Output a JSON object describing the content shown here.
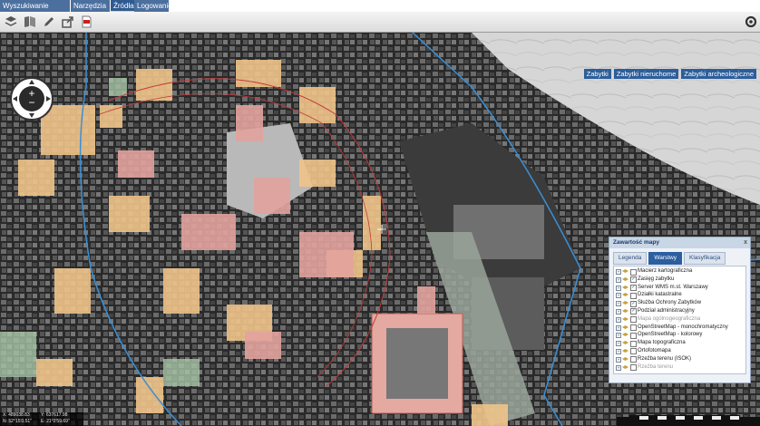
{
  "menu": {
    "tabs": [
      {
        "label": "Wyszukiwanie",
        "active": false
      },
      {
        "label": "Narzędzia",
        "active": false
      },
      {
        "label": "Źródła danych",
        "active": true
      },
      {
        "label": "Logowanie",
        "active": false
      }
    ]
  },
  "toolbar": {
    "icons": [
      "layers-icon",
      "map-theme-icon",
      "pencil-icon",
      "share-icon",
      "pdf-icon",
      "settings-icon"
    ]
  },
  "layer_switch": {
    "buttons": [
      "Zabytki",
      "Zabytki nieruchome",
      "Zabytki archeologiczne"
    ]
  },
  "panel": {
    "title": "Zawartość mapy",
    "close": "x",
    "tabs": [
      {
        "label": "Legenda",
        "active": false
      },
      {
        "label": "Warstwy",
        "active": true
      },
      {
        "label": "Klasyfikacja",
        "active": false
      }
    ],
    "layers": [
      {
        "label": "Macierz kartograficzna",
        "checked": false,
        "enabled": true
      },
      {
        "label": "Zasięg zabytku",
        "checked": true,
        "enabled": true
      },
      {
        "label": "Server WMS m.st. Warszawy",
        "checked": true,
        "enabled": true
      },
      {
        "label": "Działki katastralne",
        "checked": false,
        "enabled": true
      },
      {
        "label": "Służba Ochrony Zabytków",
        "checked": true,
        "enabled": true
      },
      {
        "label": "Podział administracyjny",
        "checked": true,
        "enabled": true
      },
      {
        "label": "Mapa ogólnogeograficzna",
        "checked": false,
        "enabled": false
      },
      {
        "label": "OpenStreetMap - monochromatyczny",
        "checked": false,
        "enabled": true
      },
      {
        "label": "OpenStreetMap - kolorowy",
        "checked": false,
        "enabled": true
      },
      {
        "label": "Mapa topograficzna",
        "checked": false,
        "enabled": true
      },
      {
        "label": "Ortofotomapa",
        "checked": false,
        "enabled": true
      },
      {
        "label": "Rzeźba terenu (ISOK)",
        "checked": false,
        "enabled": true
      },
      {
        "label": "Rzeźba terenu",
        "checked": false,
        "enabled": false
      }
    ]
  },
  "coords": {
    "x": "X: 489038.83",
    "y": "Y: 637617.98",
    "n": "N: 52°15'0.51\"",
    "e": "E: 21°0'59.69\""
  }
}
